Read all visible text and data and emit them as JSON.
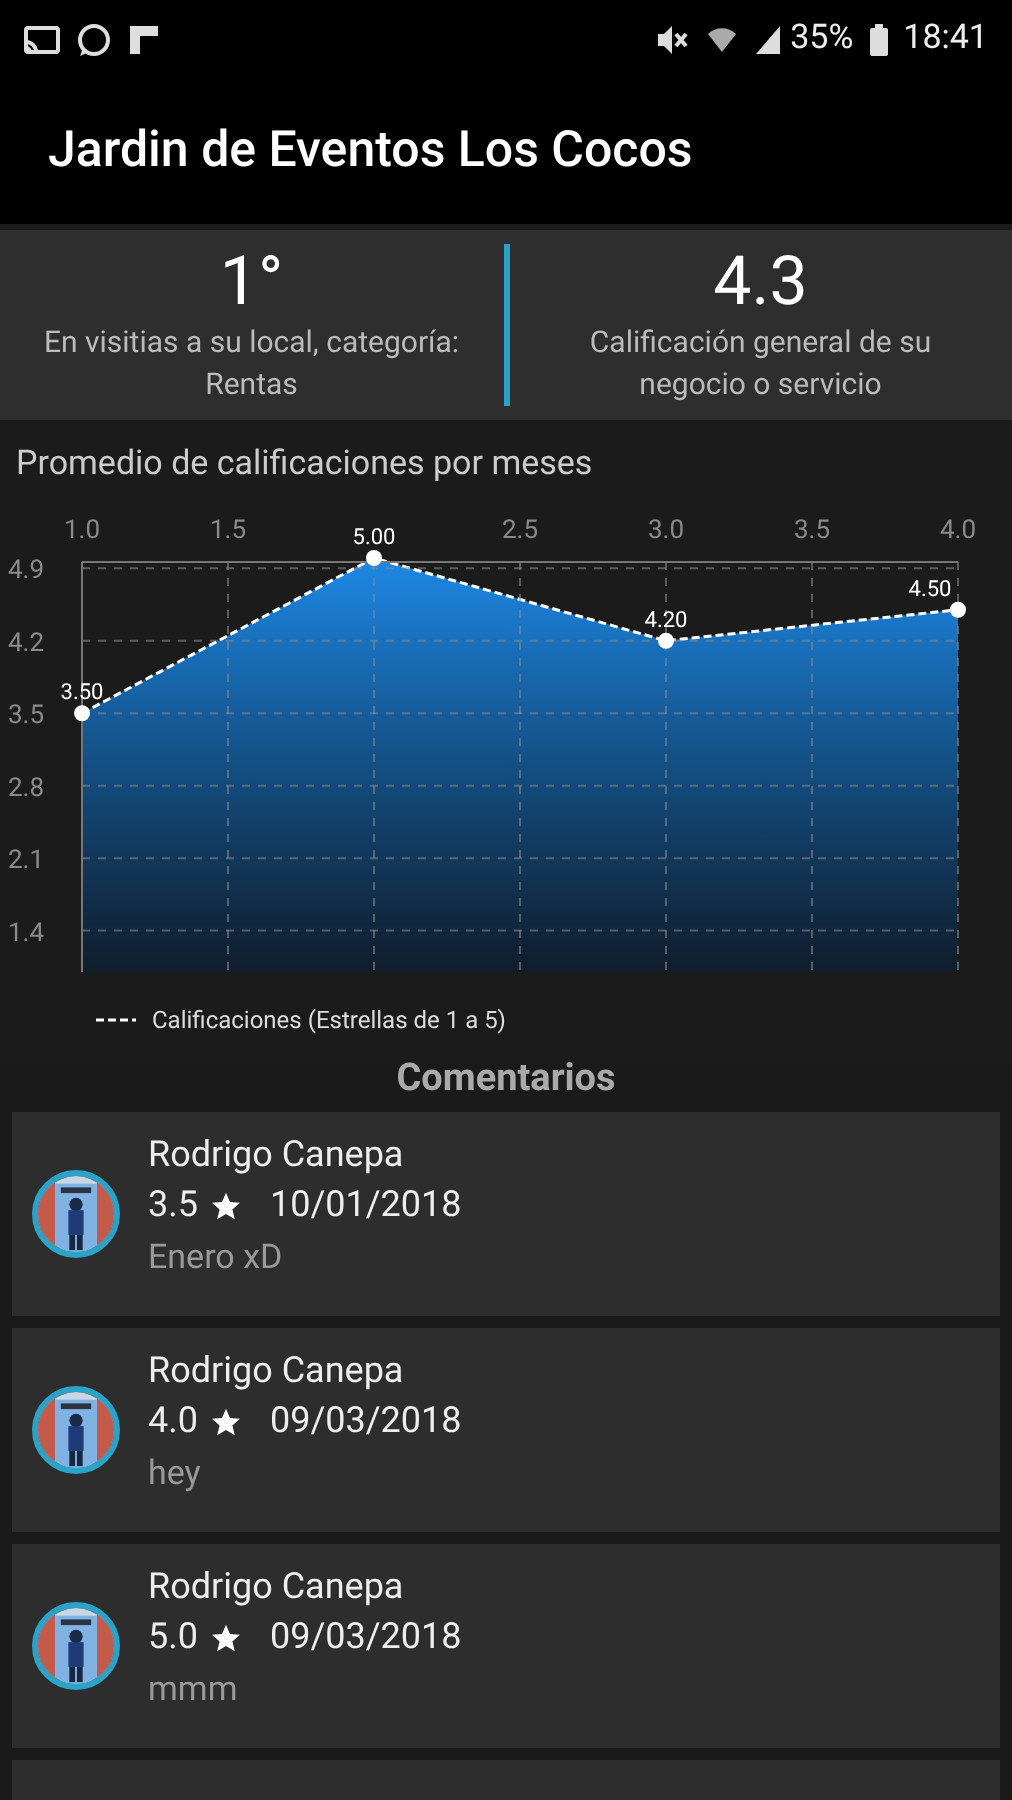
{
  "status_bar": {
    "battery": "35%",
    "time": "18:41"
  },
  "app_bar": {
    "title": "Jardin de Eventos Los Cocos"
  },
  "stats": [
    {
      "value": "1°",
      "label": "En visitias a su local, categoría: Rentas"
    },
    {
      "value": "4.3",
      "label": "Calificación general de su negocio o servicio"
    }
  ],
  "chart_section": {
    "title": "Promedio de calificaciones por meses",
    "chart_data": {
      "type": "area",
      "x": [
        1,
        2,
        3,
        4
      ],
      "series": [
        {
          "name": "Calificaciones (Estrellas de 1 a 5)",
          "color": "#1e88e5",
          "values": [
            3.5,
            5.0,
            4.2,
            4.5
          ]
        }
      ],
      "xlim": [
        1,
        4
      ],
      "ylim": [
        1,
        5
      ],
      "xticks": [
        {
          "value": 1,
          "label": "1.0"
        },
        {
          "value": 1.5,
          "label": "1.5"
        },
        {
          "value": 2.5,
          "label": "2.5"
        },
        {
          "value": 3,
          "label": "3.0"
        },
        {
          "value": 3.5,
          "label": "3.5"
        },
        {
          "value": 4,
          "label": "4.0"
        }
      ],
      "yticks": [
        1.4,
        2.1,
        2.8,
        3.5,
        4.2,
        4.9
      ],
      "grid": true,
      "value_labels": [
        "3.50",
        "5.00",
        "4.20",
        "4.50"
      ]
    }
  },
  "comments_title": "Comentarios",
  "comments": [
    {
      "name": "Rodrigo Canepa",
      "rating": "3.5",
      "date": "10/01/2018",
      "text": "Enero xD"
    },
    {
      "name": "Rodrigo Canepa",
      "rating": "4.0",
      "date": "09/03/2018",
      "text": "hey"
    },
    {
      "name": "Rodrigo Canepa",
      "rating": "5.0",
      "date": "09/03/2018",
      "text": "mmm"
    }
  ],
  "more_comments_below": true
}
